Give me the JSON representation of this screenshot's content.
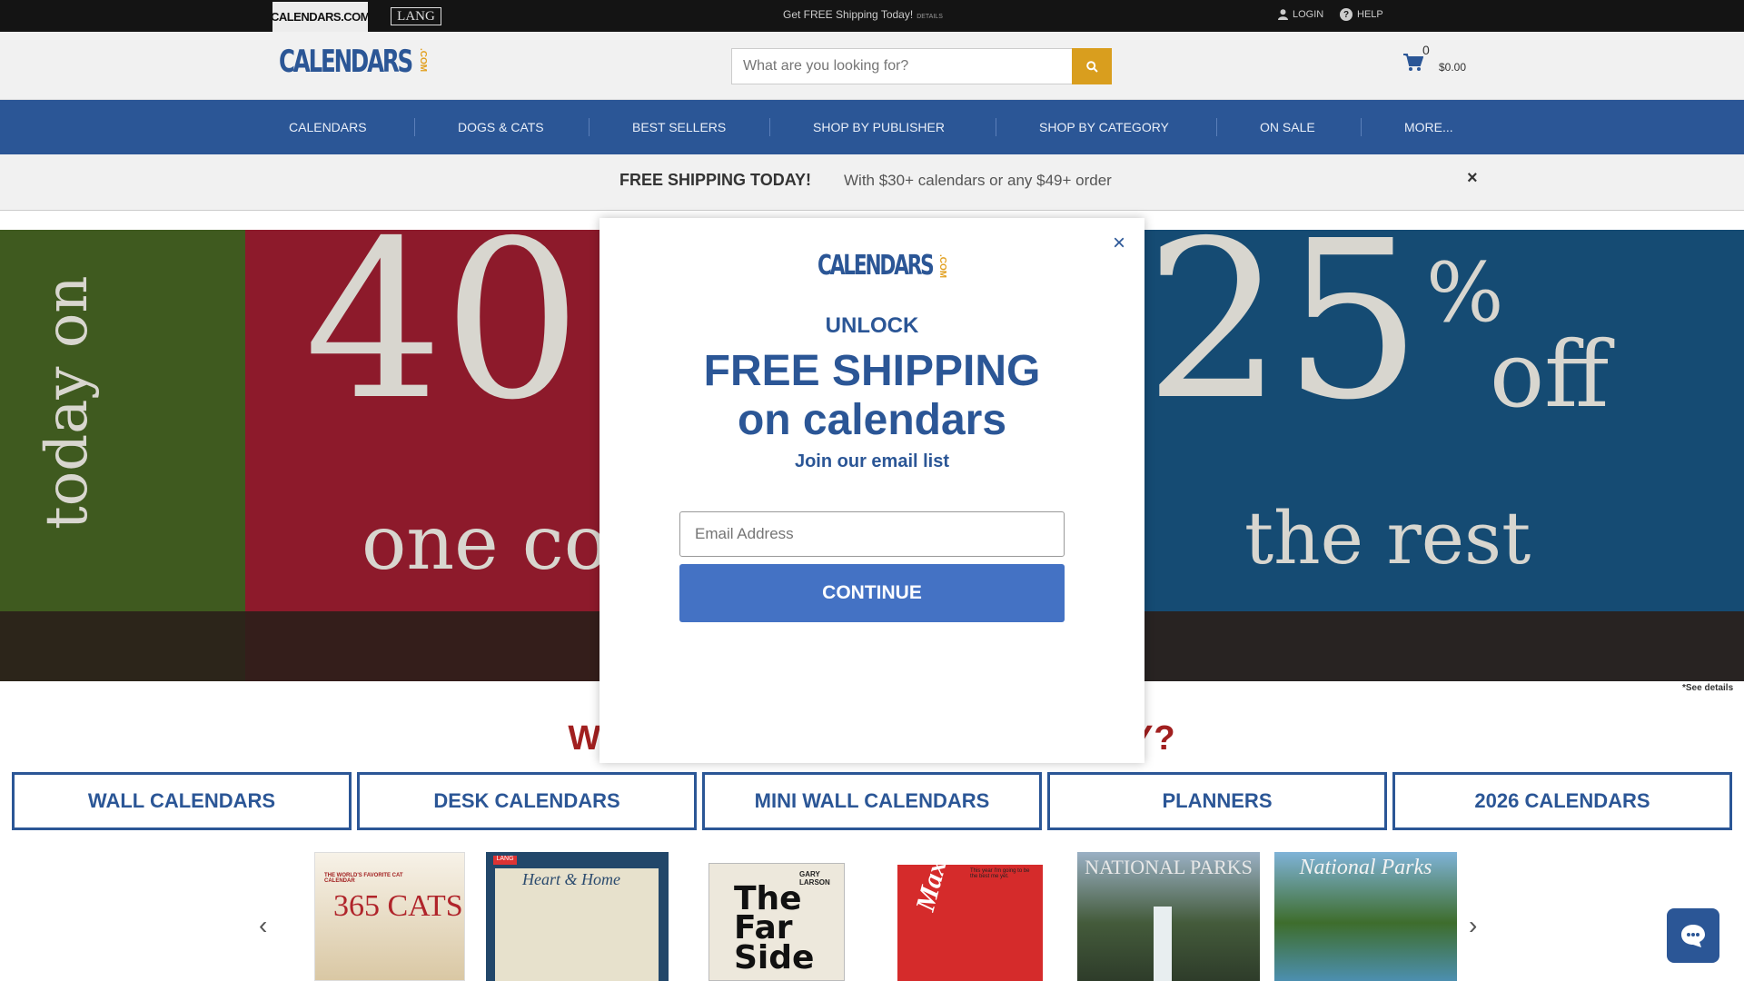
{
  "topbar": {
    "brand_calendars": "CALENDARS.COM",
    "brand_lang": "LANG",
    "promo_text": "Get FREE Shipping Today!",
    "promo_details": "DETAILS",
    "login": "LOGIN",
    "help": "HELP"
  },
  "header": {
    "logo_text": "CALENDARS",
    "logo_suffix": ".COM",
    "search_placeholder": "What are you looking for?",
    "cart_count": "0",
    "cart_total": "$0.00"
  },
  "nav": {
    "items": [
      {
        "label": "CALENDARS"
      },
      {
        "label": "DOGS & CATS"
      },
      {
        "label": "BEST SELLERS"
      },
      {
        "label": "SHOP BY PUBLISHER"
      },
      {
        "label": "SHOP BY CATEGORY"
      },
      {
        "label": "ON SALE"
      },
      {
        "label": "MORE..."
      }
    ]
  },
  "shipping_banner": {
    "headline": "FREE SHIPPING TODAY!",
    "details": "With $30+ calendars or any $49+ order",
    "close": "×"
  },
  "hero": {
    "vertical_text": "today on",
    "left_number": "40",
    "left_sub": "one co",
    "right_number": "25",
    "right_pct": "%",
    "right_off": "off",
    "right_sub": "the rest",
    "see_details": "*See details"
  },
  "shop": {
    "heading_left": "WHA",
    "heading_right": "AY?",
    "categories": [
      {
        "label": "WALL CALENDARS"
      },
      {
        "label": "DESK CALENDARS"
      },
      {
        "label": "MINI WALL CALENDARS"
      },
      {
        "label": "PLANNERS"
      },
      {
        "label": "2026 CALENDARS"
      }
    ]
  },
  "carousel": {
    "prev": "‹",
    "next": "›",
    "products": [
      {
        "title": "365 CATS",
        "top_text": "THE WORLD'S FAVORITE CAT CALENDAR"
      },
      {
        "title": "Heart & Home",
        "top_text": "LANG"
      },
      {
        "title": "The Far Side",
        "top_text": "GARY LARSON"
      },
      {
        "title": "Maxine",
        "top_text": "This year I'm going to be the best me yet."
      },
      {
        "title": "NATIONAL PARKS",
        "top_text": ""
      },
      {
        "title": "National Parks",
        "top_text": ""
      }
    ]
  },
  "modal": {
    "logo_text": "CALENDARS",
    "logo_suffix": ".COM",
    "unlock": "UNLOCK",
    "headline_1": "FREE SHIPPING",
    "headline_2": "on calendars",
    "subhead": "Join our email list",
    "email_placeholder": "Email Address",
    "continue": "CONTINUE",
    "close": "×"
  },
  "colors": {
    "brand_blue": "#2b5696",
    "accent_gold": "#d99e1e",
    "button_blue": "#4472c4",
    "heading_red": "#a11f1f"
  }
}
